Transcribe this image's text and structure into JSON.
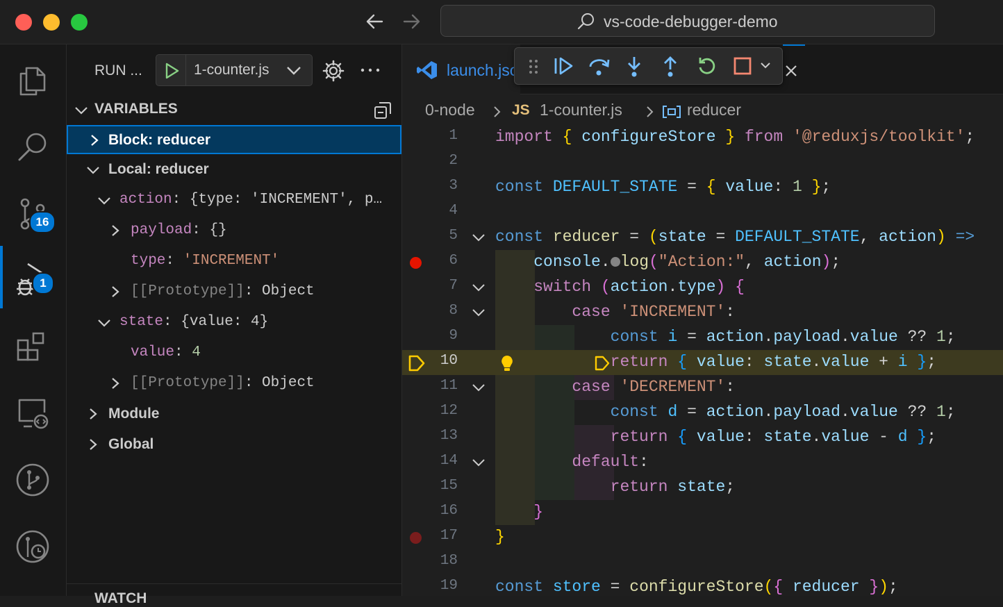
{
  "window": {
    "title": "vs-code-debugger-demo"
  },
  "sidebar": {
    "run_label": "RUN ...",
    "config_name": "1-counter.js",
    "variables_title": "VARIABLES",
    "watch_title": "WATCH"
  },
  "activity": {
    "scm_badge": "16",
    "debug_badge": "1"
  },
  "variables": {
    "block_scope": "Block: reducer",
    "local_scope": "Local: reducer",
    "action_key": "action",
    "action_val": "{type: 'INCREMENT', p…",
    "payload_key": "payload",
    "payload_val": "{}",
    "type_key": "type",
    "type_val": "'INCREMENT'",
    "proto_key": "[[Prototype]]",
    "proto_val": "Object",
    "state_key": "state",
    "state_val": "{value: 4}",
    "value_key": "value",
    "value_val": "4",
    "proto2_key": "[[Prototype]]",
    "proto2_val": "Object",
    "module_scope": "Module",
    "global_scope": "Global"
  },
  "editor": {
    "tab_name": "launch.json",
    "breadcrumb": {
      "folder": "0-node",
      "js_badge": "JS",
      "file": "1-counter.js",
      "symbol": "reducer"
    },
    "current_line": 10
  },
  "colors": {
    "accent": "#0078d4",
    "breakpoint": "#e51400",
    "current_line_arrow": "#ffcc00"
  },
  "icons": [
    "explorer-icon",
    "search-icon",
    "source-control-icon",
    "run-debug-icon",
    "extensions-icon",
    "remote-explorer-icon",
    "git-graph-icon",
    "timeline-icon"
  ]
}
